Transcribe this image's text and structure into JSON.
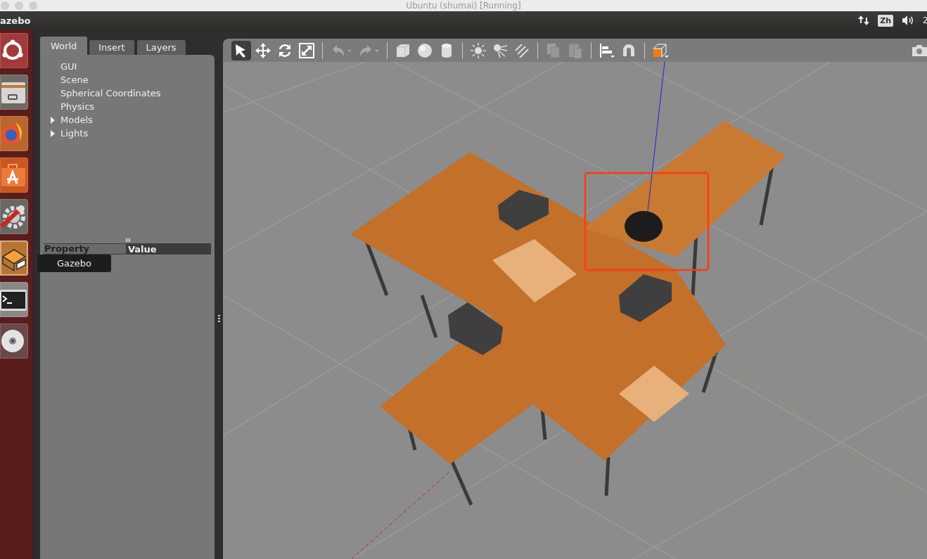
{
  "window": {
    "title": "Ubuntu (shumai) [Running]"
  },
  "top_panel": {
    "app_name": "azebo",
    "input_method": "Zh",
    "clock": "2"
  },
  "launcher": [
    {
      "kind": "ubuntu",
      "selected": false
    },
    {
      "kind": "files",
      "selected": false
    },
    {
      "kind": "browser",
      "selected": false
    },
    {
      "kind": "store",
      "selected": false
    },
    {
      "kind": "settings",
      "selected": false
    },
    {
      "kind": "gazebo",
      "selected": true
    },
    {
      "kind": "terminal",
      "selected": false
    },
    {
      "kind": "disc",
      "selected": false
    }
  ],
  "tooltip": "Gazebo",
  "tabs": [
    {
      "label": "World",
      "selected": true
    },
    {
      "label": "Insert",
      "selected": false
    },
    {
      "label": "Layers",
      "selected": false
    }
  ],
  "tree": [
    {
      "label": "GUI",
      "expandable": false
    },
    {
      "label": "Scene",
      "expandable": false
    },
    {
      "label": "Spherical Coordinates",
      "expandable": false
    },
    {
      "label": "Physics",
      "expandable": false
    },
    {
      "label": "Models",
      "expandable": true
    },
    {
      "label": "Lights",
      "expandable": true
    }
  ],
  "property_table": {
    "columns": [
      "Property",
      "Value"
    ]
  },
  "toolbar": [
    {
      "kind": "select",
      "selected": true,
      "disabled": false
    },
    {
      "kind": "translate",
      "selected": false,
      "disabled": false
    },
    {
      "kind": "rotate",
      "selected": false,
      "disabled": false
    },
    {
      "kind": "scale",
      "selected": false,
      "disabled": false
    },
    {
      "kind": "separator"
    },
    {
      "kind": "undo",
      "selected": false,
      "disabled": true
    },
    {
      "kind": "redo",
      "selected": false,
      "disabled": true
    },
    {
      "kind": "separator"
    },
    {
      "kind": "box",
      "selected": false,
      "disabled": false
    },
    {
      "kind": "sphere",
      "selected": false,
      "disabled": false
    },
    {
      "kind": "cylinder",
      "selected": false,
      "disabled": false
    },
    {
      "kind": "separator"
    },
    {
      "kind": "point-light",
      "selected": false,
      "disabled": false
    },
    {
      "kind": "spot-light",
      "selected": false,
      "disabled": false
    },
    {
      "kind": "directional-light",
      "selected": false,
      "disabled": false
    },
    {
      "kind": "separator"
    },
    {
      "kind": "copy",
      "selected": false,
      "disabled": true
    },
    {
      "kind": "paste",
      "selected": false,
      "disabled": true
    },
    {
      "kind": "separator"
    },
    {
      "kind": "align",
      "selected": false,
      "disabled": false
    },
    {
      "kind": "snap",
      "selected": false,
      "disabled": false
    },
    {
      "kind": "separator"
    },
    {
      "kind": "view-angle",
      "selected": false,
      "disabled": false
    }
  ]
}
